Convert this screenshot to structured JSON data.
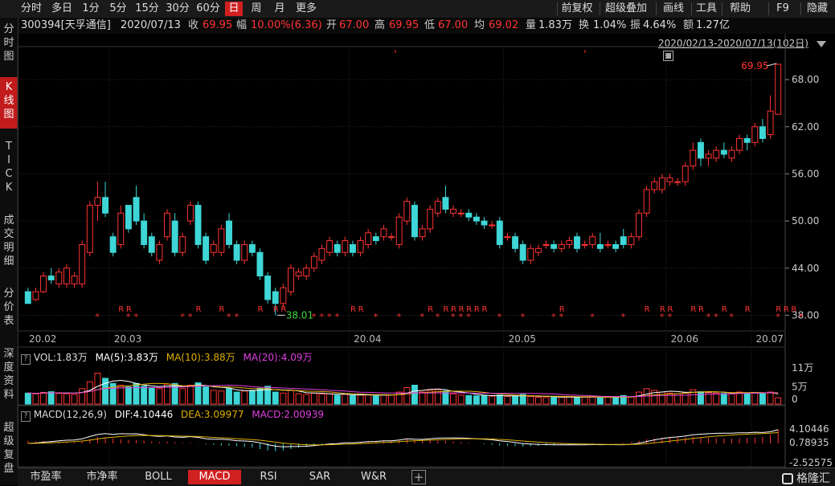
{
  "toolbar": {
    "periods": [
      "分时",
      "多日",
      "1分",
      "5分",
      "15分",
      "30分",
      "60分",
      "日",
      "周",
      "月",
      "更多"
    ],
    "active_period": "日",
    "right_tools": [
      "前复权",
      "超级叠加",
      "画线",
      "工具",
      "帮助",
      "F9",
      "隐藏"
    ]
  },
  "sidebar": {
    "items": [
      "分时图",
      "K线图",
      "TICK",
      "成交明细",
      "分价表",
      "深度资料",
      "超级复盘"
    ],
    "active": "K线图"
  },
  "quote": {
    "code_name": "300394[天孚通信]",
    "date": "2020/07/13",
    "close_label": "收",
    "close": "69.95",
    "change_label": "幅",
    "change": "10.00%(6.36)",
    "open_label": "开",
    "open": "67.00",
    "high_label": "高",
    "high": "69.95",
    "low_label": "低",
    "low": "67.00",
    "avg_label": "均",
    "avg": "69.02",
    "vol_label": "量",
    "vol": "1.83万",
    "turnover_label": "换",
    "turnover": "1.04%",
    "amp_label": "振",
    "amp": "4.64%",
    "amount_label": "额",
    "amount": "1.27亿"
  },
  "date_range": "2020/02/13-2020/07/13(102日)",
  "volume_legend": {
    "vol": "VOL:1.83万",
    "ma5": "MA(5):3.83万",
    "ma10": "MA(10):3.88万",
    "ma20": "MA(20):4.09万"
  },
  "macd_legend": {
    "name": "MACD(12,26,9)",
    "dif": "DIF:4.10446",
    "dea": "DEA:3.09977",
    "macd": "MACD:2.00939"
  },
  "bottom_tabs": [
    "市盈率",
    "市净率",
    "BOLL",
    "MACD",
    "RSI",
    "SAR",
    "W&R"
  ],
  "active_bottom_tab": "MACD",
  "watermark": "格隆汇",
  "colors": {
    "up": "#ff3232",
    "down": "#3ed6d6",
    "ma5": "#ffffff",
    "ma10": "#e0b000",
    "ma20": "#e040e0",
    "dif": "#ffffff",
    "dea": "#e0b000"
  },
  "chart_data": {
    "type": "candlestick",
    "price_ylim": [
      36,
      72
    ],
    "price_ticks": [
      "68.00",
      "62.00",
      "56.00",
      "50.00",
      "44.00",
      "38.00"
    ],
    "x_ticks": [
      "20.02",
      "20.03",
      "20.04",
      "20.05",
      "20.06",
      "20.07"
    ],
    "annotations": {
      "high": "69.95",
      "low": "38.01"
    },
    "volume_ticks": [
      "11万",
      "5万",
      "0"
    ],
    "macd_ticks": [
      "4.10446",
      "0.78935",
      "-2.52575"
    ],
    "candles": [
      [
        41,
        39.5,
        41.5,
        39.5
      ],
      [
        40,
        41,
        41.5,
        39.8
      ],
      [
        41,
        43,
        43.5,
        40.8
      ],
      [
        43,
        42.5,
        44,
        42
      ],
      [
        42,
        43.5,
        44,
        41.5
      ],
      [
        42,
        44,
        44.5,
        41.5
      ],
      [
        42,
        43,
        43.5,
        41.5
      ],
      [
        42,
        47,
        47.5,
        41.5
      ],
      [
        46,
        52,
        52.5,
        45.5
      ],
      [
        52,
        53,
        55,
        50
      ],
      [
        53,
        51,
        55,
        50.5
      ],
      [
        48,
        46,
        48.5,
        45.5
      ],
      [
        47,
        51,
        52,
        46.5
      ],
      [
        52,
        49,
        52,
        48.5
      ],
      [
        53,
        50,
        54.5,
        49.5
      ],
      [
        50,
        47,
        51,
        46.5
      ],
      [
        48,
        46,
        48.5,
        45.5
      ],
      [
        45,
        47,
        47.5,
        44.5
      ],
      [
        48,
        51,
        51.5,
        47.5
      ],
      [
        50,
        46,
        51,
        45.5
      ],
      [
        46,
        48,
        48.5,
        45.5
      ],
      [
        50,
        52,
        52.5,
        49.5
      ],
      [
        52,
        47,
        52.5,
        46.5
      ],
      [
        48,
        45,
        48.5,
        44.5
      ],
      [
        46,
        47,
        47.5,
        45.5
      ],
      [
        46,
        49,
        49.5,
        45.5
      ],
      [
        50,
        47,
        51,
        46.5
      ],
      [
        47,
        45,
        47.5,
        44.5
      ],
      [
        45,
        47,
        47.5,
        44.5
      ],
      [
        47,
        46,
        47.5,
        45.5
      ],
      [
        46,
        43,
        46.5,
        42.5
      ],
      [
        43,
        40,
        43.5,
        39.5
      ],
      [
        41,
        39.5,
        41.5,
        38.01
      ],
      [
        39.5,
        41.5,
        42,
        39
      ],
      [
        41,
        44,
        44.5,
        40.5
      ],
      [
        43,
        43.5,
        44,
        42.5
      ],
      [
        43,
        44,
        44.5,
        42.5
      ],
      [
        44,
        45.5,
        46,
        43.5
      ],
      [
        45,
        46.5,
        47,
        44.5
      ],
      [
        46,
        47.5,
        48,
        45.5
      ],
      [
        47,
        46,
        47.5,
        45.5
      ],
      [
        46,
        47.5,
        48,
        45.5
      ],
      [
        47,
        46,
        47.5,
        45.5
      ],
      [
        46,
        47.5,
        48,
        45.5
      ],
      [
        47,
        48.5,
        49,
        46.5
      ],
      [
        48,
        47.5,
        48.5,
        47
      ],
      [
        48,
        49,
        49.5,
        47.5
      ],
      [
        48,
        48,
        48.5,
        47.5
      ],
      [
        47,
        50.5,
        51,
        46.5
      ],
      [
        50,
        52.5,
        53,
        49.5
      ],
      [
        52,
        48,
        52.5,
        47.5
      ],
      [
        48,
        49,
        49.5,
        47.5
      ],
      [
        49,
        51.5,
        52,
        48.5
      ],
      [
        51,
        52.5,
        53,
        50.5
      ],
      [
        53,
        51.5,
        54.5,
        51
      ],
      [
        51,
        51.5,
        52,
        50.5
      ],
      [
        51,
        51,
        51.5,
        50.5
      ],
      [
        51,
        50.5,
        51.5,
        50
      ],
      [
        50.5,
        50,
        51,
        49.5
      ],
      [
        50,
        49.5,
        50.5,
        49
      ],
      [
        49.5,
        49.5,
        50,
        49
      ],
      [
        50,
        47,
        50.5,
        46.5
      ],
      [
        48,
        48,
        48.5,
        47.5
      ],
      [
        48,
        46.5,
        48.5,
        46
      ],
      [
        47,
        45,
        47.5,
        44.5
      ],
      [
        45,
        46.5,
        47,
        44.5
      ],
      [
        46,
        46.5,
        47,
        45.5
      ],
      [
        47,
        47,
        47.5,
        46.5
      ],
      [
        47,
        46.5,
        47.5,
        46
      ],
      [
        46.5,
        47,
        47.5,
        46
      ],
      [
        47,
        47.5,
        48,
        46.5
      ],
      [
        48,
        46.5,
        48.5,
        46
      ],
      [
        47,
        47,
        47.5,
        46.5
      ],
      [
        47,
        48,
        48.5,
        46.5
      ],
      [
        47,
        46.5,
        48.5,
        46
      ],
      [
        47,
        47,
        47.5,
        46.5
      ],
      [
        47,
        46.5,
        47.5,
        46
      ],
      [
        48,
        47,
        49,
        46.5
      ],
      [
        47,
        48,
        48.5,
        46.5
      ],
      [
        48,
        51,
        51.5,
        47.5
      ],
      [
        51,
        54,
        54.5,
        50.5
      ],
      [
        54,
        55,
        55.5,
        53.5
      ],
      [
        54,
        55.5,
        56,
        53.5
      ],
      [
        55,
        55.5,
        56,
        54.5
      ],
      [
        55,
        55,
        55.5,
        54.5
      ],
      [
        55,
        57,
        57.5,
        54.5
      ],
      [
        57,
        59,
        60,
        56.5
      ],
      [
        60,
        58,
        60.5,
        57
      ],
      [
        58,
        58.5,
        59,
        57
      ],
      [
        58,
        59,
        59.5,
        57.5
      ],
      [
        59,
        58.5,
        60,
        58
      ],
      [
        58,
        59,
        59.5,
        57.5
      ],
      [
        59,
        60.5,
        61,
        58.5
      ],
      [
        60.5,
        60,
        61,
        59
      ],
      [
        60,
        62,
        62.5,
        59.5
      ],
      [
        62,
        60.5,
        63,
        60
      ],
      [
        61,
        64,
        66,
        60.5
      ],
      [
        63.59,
        69.95,
        69.95,
        67
      ]
    ],
    "volumes_wan": [
      3.2,
      3.0,
      3.4,
      3.6,
      3.1,
      3.0,
      2.8,
      4.5,
      6.5,
      9.0,
      7.5,
      6.0,
      5.5,
      5.0,
      6.0,
      5.2,
      4.8,
      4.5,
      5.8,
      6.0,
      4.5,
      5.5,
      6.2,
      5.0,
      4.0,
      3.8,
      4.5,
      3.5,
      3.8,
      4.0,
      4.6,
      5.2,
      3.5,
      3.2,
      4.0,
      3.0,
      2.8,
      3.2,
      2.9,
      3.0,
      2.6,
      2.8,
      2.5,
      2.6,
      2.8,
      2.4,
      2.7,
      2.6,
      3.5,
      4.8,
      5.5,
      3.5,
      4.0,
      4.2,
      3.8,
      3.0,
      2.6,
      2.5,
      2.4,
      2.5,
      2.3,
      2.6,
      2.2,
      2.3,
      2.8,
      2.2,
      2.0,
      1.9,
      2.1,
      2.0,
      2.2,
      1.9,
      2.0,
      2.3,
      1.8,
      2.0,
      1.9,
      2.5,
      2.1,
      3.5,
      4.5,
      4.0,
      3.5,
      3.2,
      3.0,
      3.4,
      4.2,
      3.6,
      3.3,
      3.2,
      3.1,
      3.0,
      3.5,
      3.2,
      3.4,
      3.0,
      3.5,
      1.83
    ],
    "macd_hist": [
      0.4,
      0.3,
      0.35,
      0.3,
      0.25,
      0.2,
      0.15,
      0.3,
      0.6,
      0.9,
      0.8,
      0.7,
      0.6,
      0.5,
      0.5,
      0.4,
      0.3,
      0.2,
      0.25,
      0.2,
      0.1,
      0.1,
      0.05,
      -0.1,
      -0.2,
      -0.3,
      -0.3,
      -0.4,
      -0.5,
      -0.6,
      -0.8,
      -1.0,
      -1.1,
      -1.0,
      -0.8,
      -0.6,
      -0.5,
      -0.3,
      -0.2,
      -0.1,
      0.05,
      0.1,
      0.15,
      0.2,
      0.25,
      0.3,
      0.35,
      0.3,
      0.4,
      0.6,
      0.5,
      0.4,
      0.4,
      0.4,
      0.35,
      0.3,
      0.2,
      0.1,
      0.0,
      -0.1,
      -0.2,
      -0.3,
      -0.35,
      -0.4,
      -0.45,
      -0.4,
      -0.35,
      -0.3,
      -0.25,
      -0.2,
      -0.15,
      -0.1,
      -0.08,
      -0.05,
      -0.03,
      0.0,
      0.05,
      0.1,
      0.2,
      0.4,
      0.6,
      0.7,
      0.8,
      0.85,
      0.8,
      0.85,
      0.9,
      0.85,
      0.8,
      0.75,
      0.7,
      0.7,
      0.75,
      0.8,
      0.85,
      0.9,
      1.2,
      2.0
    ],
    "r_markers": [
      12,
      13,
      22,
      25,
      30,
      32,
      33,
      42,
      43,
      52,
      54,
      55,
      56,
      57,
      58,
      59,
      69,
      80,
      82,
      83,
      86,
      87,
      90,
      93,
      97,
      98,
      99
    ],
    "star_markers": [
      9,
      13,
      14,
      20,
      21,
      26,
      27,
      37,
      38,
      39,
      40,
      45,
      48,
      51,
      53,
      55,
      56,
      57,
      61,
      64,
      68,
      69,
      73,
      77,
      82,
      83,
      88,
      89,
      91,
      97,
      100
    ]
  }
}
